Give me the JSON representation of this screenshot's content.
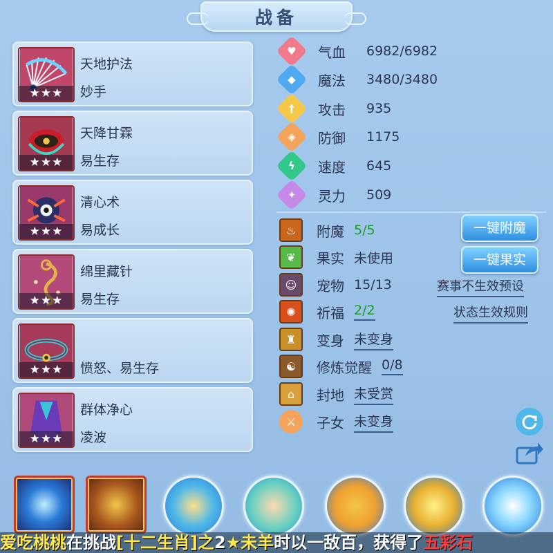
{
  "title": "战备",
  "skills": [
    {
      "name": "天地护法",
      "sub": "妙手",
      "stars": "★★★",
      "art": "fan-art"
    },
    {
      "name": "天降甘霖",
      "sub": "易生存",
      "stars": "★★★",
      "art": "feather-art"
    },
    {
      "name": "清心术",
      "sub": "易成长",
      "stars": "★★★",
      "art": "mask-art"
    },
    {
      "name": "绵里藏针",
      "sub": "易生存",
      "stars": "★★★",
      "art": "rope-art"
    },
    {
      "name": "",
      "sub": "愤怒、易生存",
      "stars": "★★★",
      "art": "belt-art"
    },
    {
      "name": "群体净心",
      "sub": "凌波",
      "stars": "★★★",
      "art": "robe-art"
    }
  ],
  "attributes": [
    {
      "label": "气血",
      "value": "6982/6982",
      "icon": "heart-icon",
      "color": "#f07a8a"
    },
    {
      "label": "魔法",
      "value": "3480/3480",
      "icon": "shield-icon",
      "color": "#4fa9f0"
    },
    {
      "label": "攻击",
      "value": "935",
      "icon": "sword-icon",
      "color": "#f5c84a"
    },
    {
      "label": "防御",
      "value": "1175",
      "icon": "armor-icon",
      "color": "#f4a35a"
    },
    {
      "label": "速度",
      "value": "645",
      "icon": "lightning-icon",
      "color": "#32c88a"
    },
    {
      "label": "灵力",
      "value": "509",
      "icon": "spirit-icon",
      "color": "#c58ae8"
    }
  ],
  "extras": [
    {
      "label": "附魔",
      "value": "5/5",
      "icon": "enchant-icon"
    },
    {
      "label": "果实",
      "value": "未使用",
      "icon": "fruit-icon"
    },
    {
      "label": "宠物",
      "value": "15/13",
      "icon": "pet-icon"
    },
    {
      "label": "祈福",
      "value": "2/2",
      "icon": "blessing-icon"
    },
    {
      "label": "变身",
      "value": "未变身",
      "icon": "transform-icon"
    },
    {
      "label": "修炼觉醒",
      "value": "0/8",
      "icon": "cultivation-icon"
    },
    {
      "label": "封地",
      "value": "未受赏",
      "icon": "fief-icon"
    },
    {
      "label": "子女",
      "value": "未变身",
      "icon": "children-icon"
    }
  ],
  "buttons": {
    "enchant_all": "一键附魔",
    "fruit_all": "一键果实"
  },
  "links": {
    "preset": "赛事不生效预设",
    "rules": "状态生效规则"
  },
  "ticker": {
    "parts": [
      {
        "text": "爱吃桃桃",
        "color": "#ffe84a"
      },
      {
        "text": "在挑战",
        "color": "#ffffff"
      },
      {
        "text": "[十二生肖]之",
        "color": "#ffe84a"
      },
      {
        "text": "2",
        "color": "#ffffff"
      },
      {
        "text": "★未羊",
        "color": "#ffe84a"
      },
      {
        "text": "时以一敌百，获得了",
        "color": "#ffffff"
      },
      {
        "text": "五彩石",
        "color": "#ff3b3b"
      }
    ]
  }
}
